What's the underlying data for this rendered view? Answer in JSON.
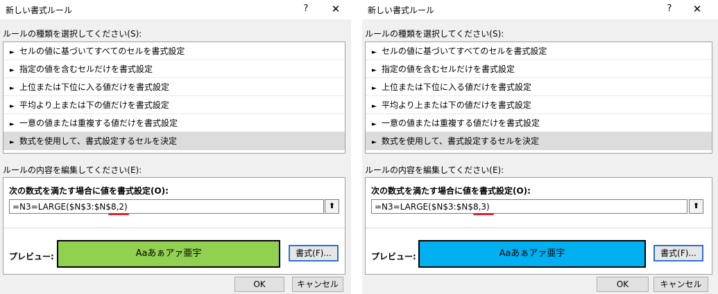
{
  "dialogs": [
    {
      "title": "新しい書式ルール",
      "help": "?",
      "close": "✕",
      "rule_type_label": "ルールの種類を選択してください(S):",
      "rule_types": [
        "セルの値に基づいてすべてのセルを書式設定",
        "指定の値を含むセルだけを書式設定",
        "上位または下位に入る値だけを書式設定",
        "平均より上または下の値だけを書式設定",
        "一意の値または重複する値だけを書式設定",
        "数式を使用して、書式設定するセルを決定"
      ],
      "selected_rule_index": 5,
      "edit_label": "ルールの内容を編集してください(E):",
      "condition_label": "次の数式を満たす場合に値を書式設定(O):",
      "formula": "=N3=LARGE($N$3:$N$8,2)",
      "preview_label": "プレビュー:",
      "preview_text": "Aaあぁアァ亜宇",
      "preview_color": "#92d050",
      "format_button": "書式(F)...",
      "ok": "OK",
      "cancel": "キャンセル"
    },
    {
      "title": "新しい書式ルール",
      "help": "?",
      "close": "✕",
      "rule_type_label": "ルールの種類を選択してください(S):",
      "rule_types": [
        "セルの値に基づいてすべてのセルを書式設定",
        "指定の値を含むセルだけを書式設定",
        "上位または下位に入る値だけを書式設定",
        "平均より上または下の値だけを書式設定",
        "一意の値または重複する値だけを書式設定",
        "数式を使用して、書式設定するセルを決定"
      ],
      "selected_rule_index": 5,
      "edit_label": "ルールの内容を編集してください(E):",
      "condition_label": "次の数式を満たす場合に値を書式設定(O):",
      "formula": "=N3=LARGE($N$3:$N$8,3)",
      "preview_label": "プレビュー:",
      "preview_text": "Aaあぁアァ亜宇",
      "preview_color": "#00b0f0",
      "format_button": "書式(F)...",
      "ok": "OK",
      "cancel": "キャンセル"
    }
  ],
  "icons": {
    "rule_arrow": "arrow-right-icon",
    "collapse": "collapse-dialog-icon"
  },
  "colors": {
    "highlight_mark": "#e0202e",
    "focus_border": "#2b6fd0"
  }
}
